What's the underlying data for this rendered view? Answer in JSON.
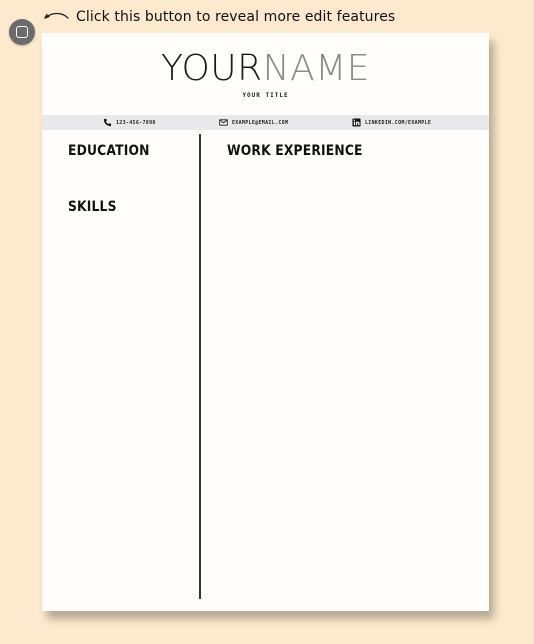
{
  "hint": {
    "text": "Click this button to reveal more edit features",
    "arrow_icon": "curved-arrow-left-icon"
  },
  "edit_button": {
    "icon": "square-icon",
    "color": "#6b6b6b"
  },
  "colors": {
    "background": "#fde9cd",
    "page": "#fffefb",
    "contact_bar": "#e9e9ec",
    "name_first": "#1a1a1a",
    "name_last": "#8a8a8a"
  },
  "resume": {
    "name_first": "YOUR",
    "name_last": "NAME",
    "title": "YOUR TITLE",
    "contact": {
      "phone": "123-456-7890",
      "email": "EXAMPLE@EMAIL.COM",
      "linkedin": "LINKEDIN.COM/EXAMPLE"
    },
    "sections": {
      "education": "EDUCATION",
      "skills": "SKILLS",
      "work_experience": "WORK EXPERIENCE"
    }
  }
}
